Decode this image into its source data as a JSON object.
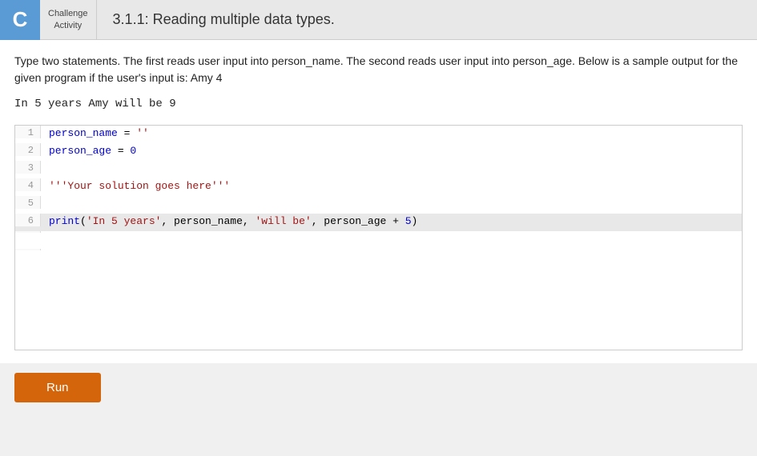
{
  "header": {
    "logo_letter": "C",
    "activity_line1": "Challenge",
    "activity_line2": "Activity",
    "title": "3.1.1: Reading multiple data types."
  },
  "description": {
    "text": "Type two statements. The first reads user input into person_name. The second reads user input into person_age. Below is a sample output for the given program if the user's input is: Amy 4"
  },
  "sample_output": "In 5 years Amy will be 9",
  "code_lines": [
    {
      "num": 1,
      "content": "person_name = ''",
      "active": false
    },
    {
      "num": 2,
      "content": "person_age = 0",
      "active": false
    },
    {
      "num": 3,
      "content": "",
      "active": false
    },
    {
      "num": 4,
      "content": "'''Your solution goes here'''",
      "active": false
    },
    {
      "num": 5,
      "content": "",
      "active": false
    },
    {
      "num": 6,
      "content": "print('In 5 years', person_name, 'will be', person_age + 5)",
      "active": true
    }
  ],
  "run_button_label": "Run"
}
